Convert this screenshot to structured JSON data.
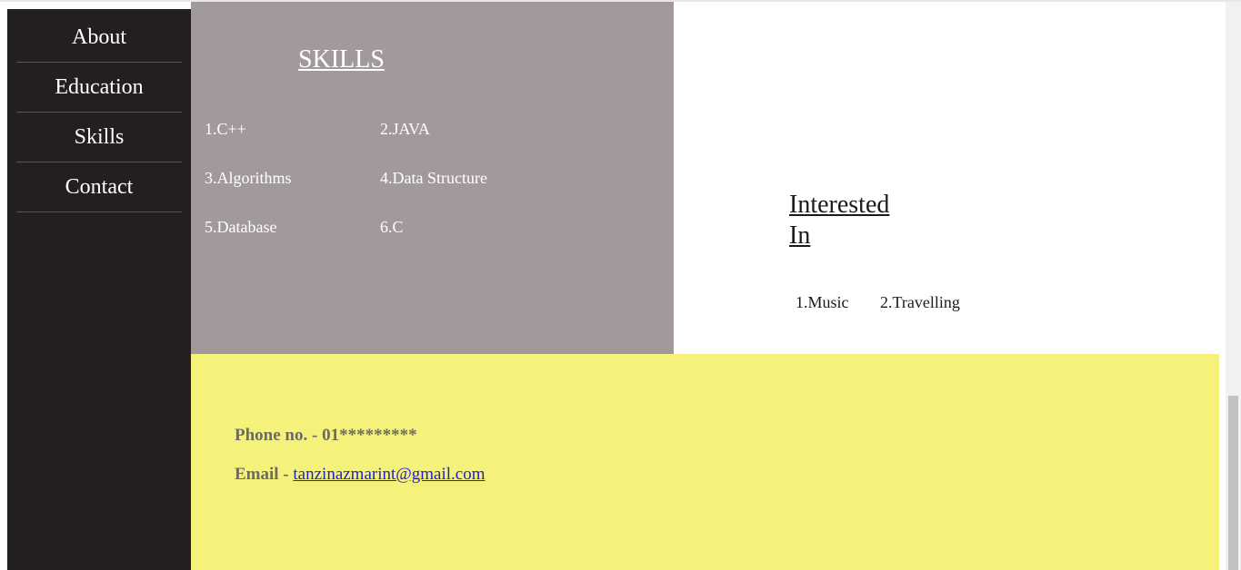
{
  "sidebar": {
    "items": [
      {
        "label": "About"
      },
      {
        "label": "Education"
      },
      {
        "label": "Skills"
      },
      {
        "label": "Contact"
      }
    ]
  },
  "skills": {
    "title": "SKILLS",
    "items": [
      "1.C++",
      "2.JAVA",
      "3.Algorithms",
      "4.Data Structure",
      "5.Database",
      "6.C"
    ]
  },
  "interests": {
    "title_line1": "Interested",
    "title_line2": "In",
    "items": [
      "1.Music",
      "2.Travelling"
    ]
  },
  "contact": {
    "phone_label": "Phone no. - 01*********",
    "email_prefix": "Email - ",
    "email_link": "tanzinazmarint@gmail.com"
  },
  "colors": {
    "sidebar_bg": "#231f1f",
    "skills_bg": "#a29a9a",
    "contact_bg": "#f4f27a",
    "link": "#1f1fcc"
  }
}
